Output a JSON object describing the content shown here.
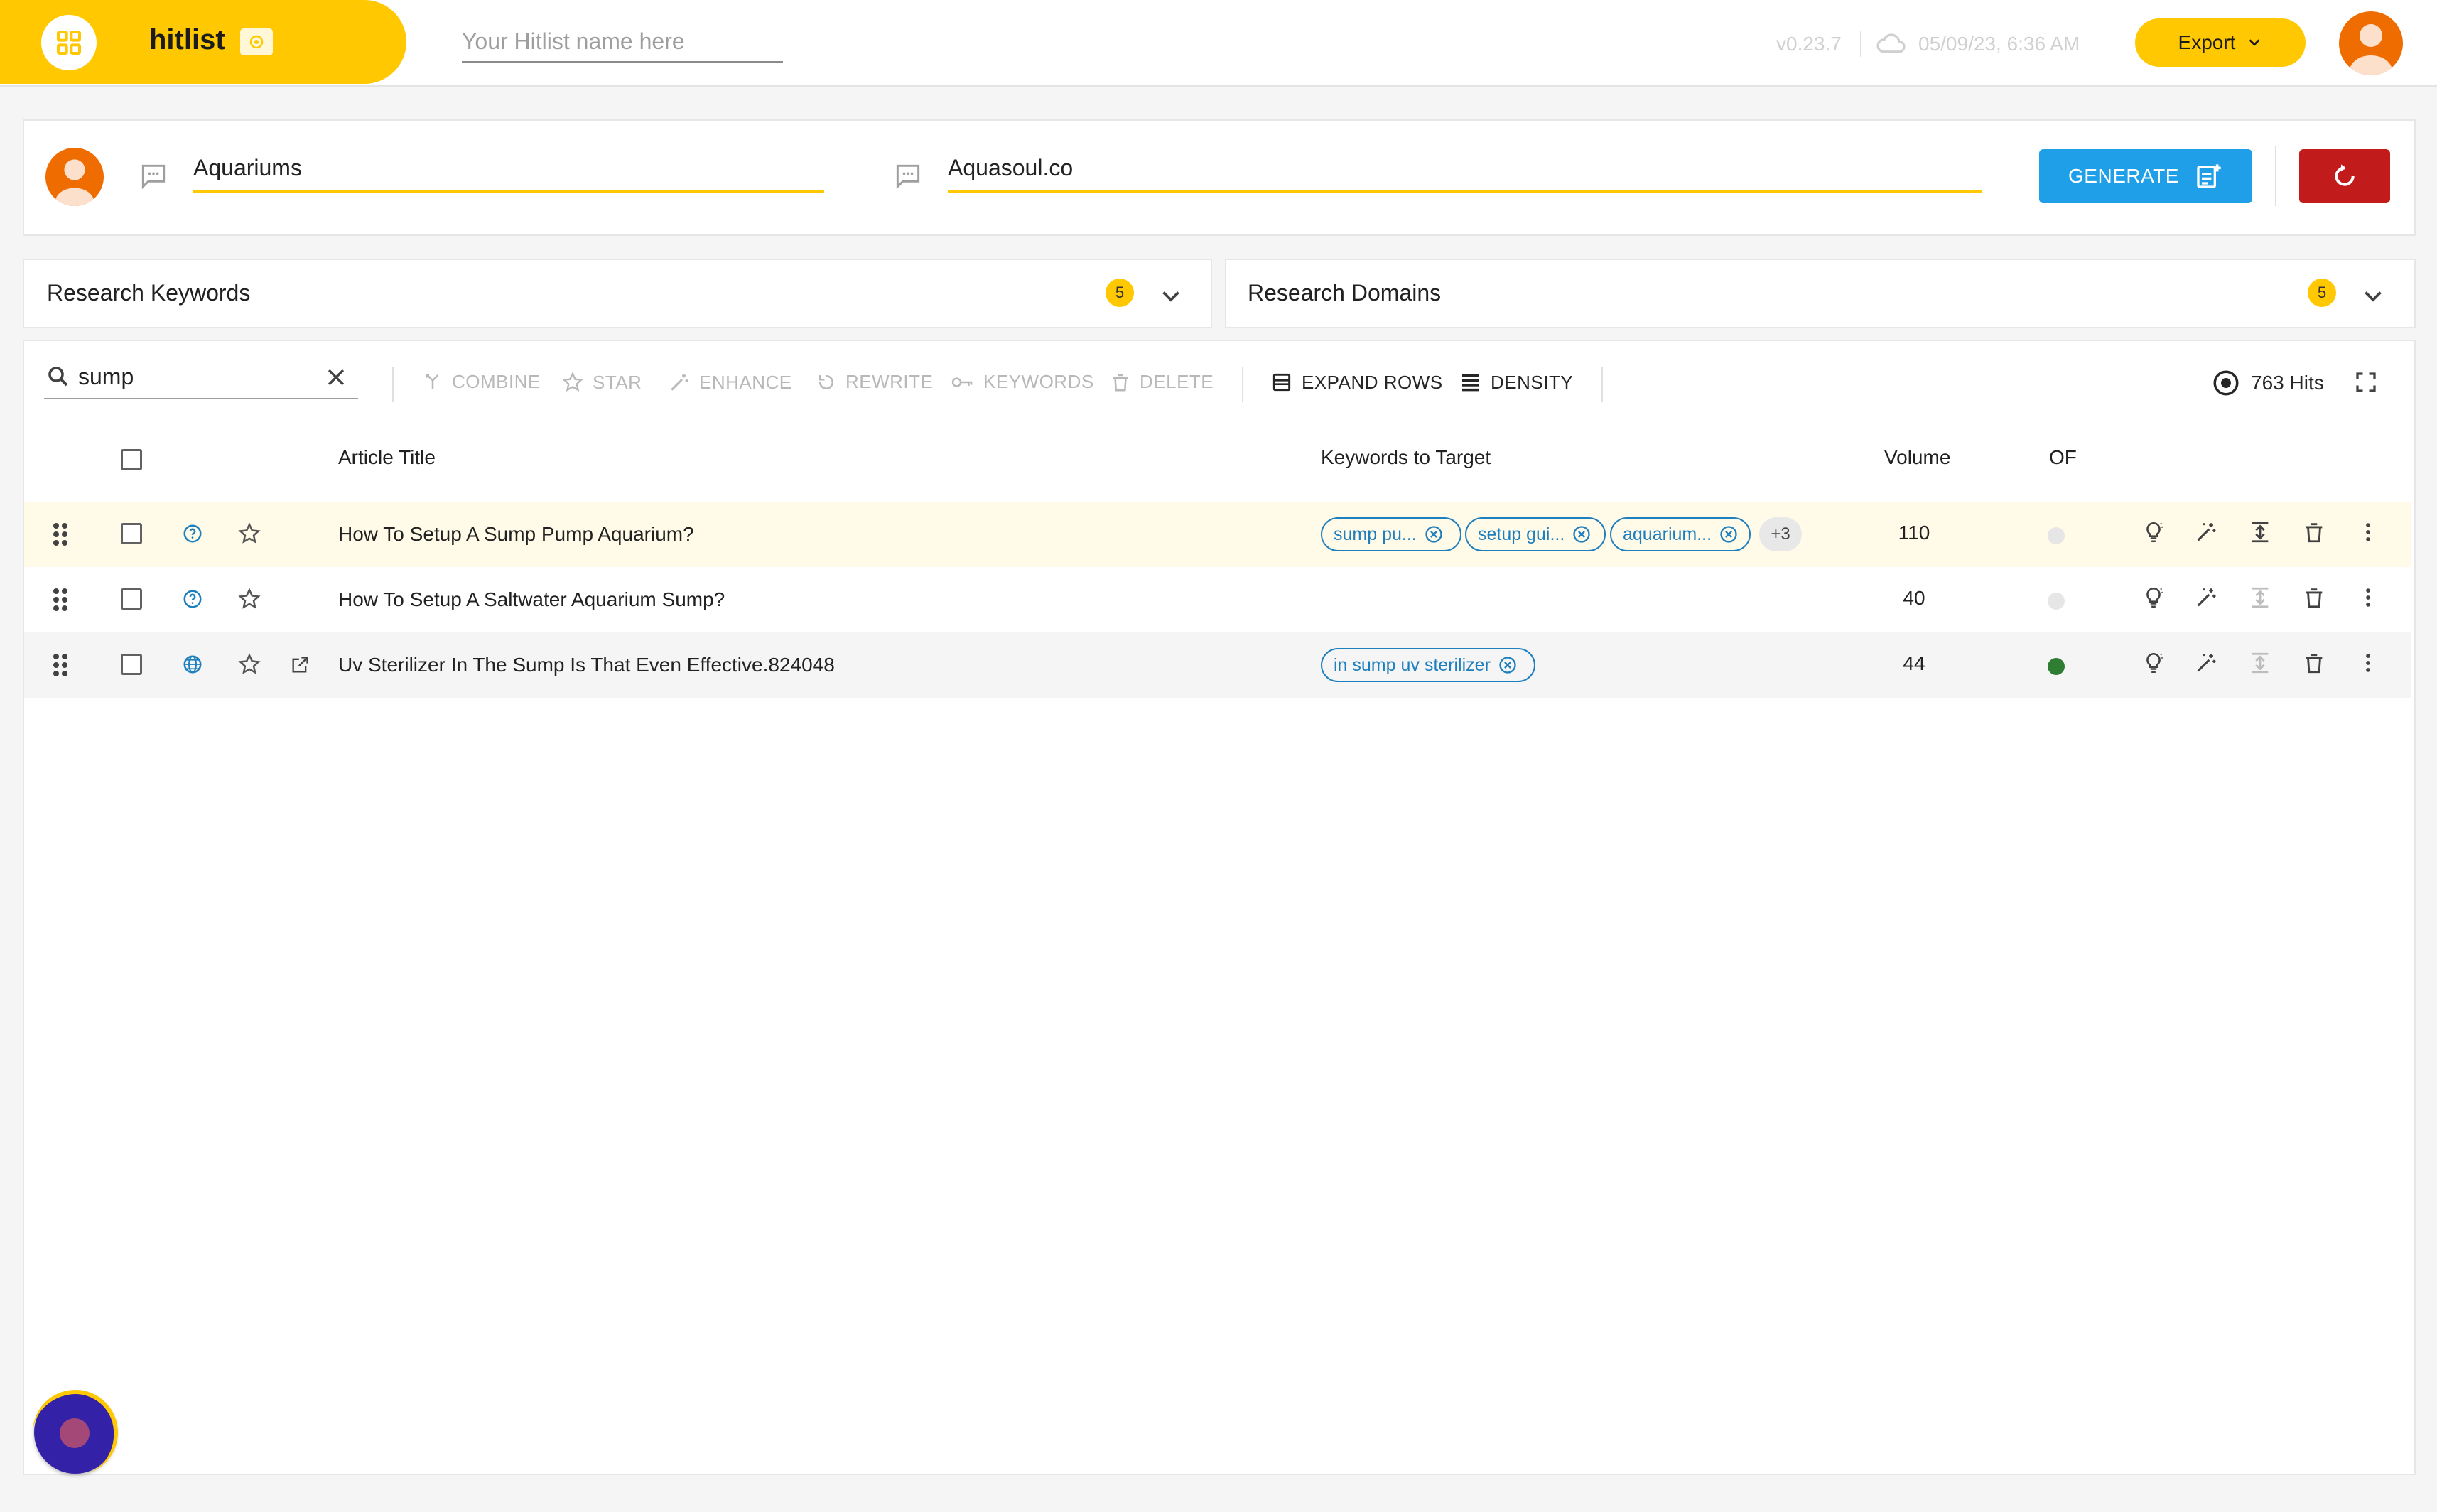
{
  "app": {
    "brand_name": "hitlist",
    "hitlist_name_placeholder": "Your Hitlist name here",
    "version": "v0.23.7",
    "last_saved": "05/09/23, 6:36 AM",
    "export_label": "Export",
    "accent_color": "#ffc800"
  },
  "generator": {
    "topic_value": "Aquariums",
    "domain_value": "Aquasoul.co",
    "generate_label": "GENERATE",
    "generate_color": "#1e9fe8",
    "reset_color": "#c21b1b"
  },
  "research": {
    "keywords": {
      "title": "Research Keywords",
      "count": "5"
    },
    "domains": {
      "title": "Research Domains",
      "count": "5"
    }
  },
  "toolbar": {
    "search_value": "sump",
    "combine": "COMBINE",
    "star": "STAR",
    "enhance": "ENHANCE",
    "rewrite": "REWRITE",
    "keywords": "KEYWORDS",
    "delete": "DELETE",
    "expand_rows": "EXPAND ROWS",
    "density": "DENSITY",
    "hits": "763 Hits"
  },
  "table": {
    "headers": {
      "title": "Article Title",
      "keywords": "Keywords to Target",
      "volume": "Volume",
      "of": "OF"
    },
    "rows": [
      {
        "type_icon": "question-icon",
        "title": "How To Setup A Sump Pump Aquarium?",
        "keywords": [
          "sump pu...",
          "setup gui...",
          "aquarium..."
        ],
        "more": "+3",
        "volume": "110",
        "of_status": "none"
      },
      {
        "type_icon": "question-icon",
        "title": "How To Setup A Saltwater Aquarium Sump?",
        "keywords": [],
        "volume": "40",
        "of_status": "none"
      },
      {
        "type_icon": "globe-icon",
        "title": "Uv Sterilizer In The Sump Is That Even Effective.824048",
        "keywords": [
          "in sump uv sterilizer"
        ],
        "volume": "44",
        "of_status": "active"
      }
    ]
  }
}
